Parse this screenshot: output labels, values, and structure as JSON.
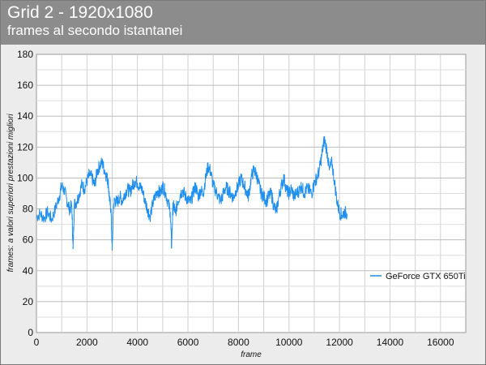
{
  "chart_data": {
    "type": "line",
    "title": "Grid 2 - 1920x1080",
    "subtitle": "frames al secondo istantanei",
    "xlabel": "frame",
    "ylabel": "frames: a valori superiori prestazioni migliori",
    "xlim": [
      0,
      17000
    ],
    "ylim": [
      0,
      180
    ],
    "x_ticks": [
      0,
      2000,
      4000,
      6000,
      8000,
      10000,
      12000,
      14000,
      16000
    ],
    "y_ticks": [
      0,
      20,
      40,
      60,
      80,
      100,
      120,
      140,
      160,
      180
    ],
    "grid": true,
    "legend_position": "right",
    "series": [
      {
        "name": "GeForce GTX 650Ti",
        "color": "#1f8ff0",
        "x": [
          0,
          150,
          300,
          450,
          600,
          750,
          900,
          1000,
          1100,
          1200,
          1300,
          1400,
          1450,
          1500,
          1600,
          1700,
          1800,
          1900,
          2000,
          2100,
          2200,
          2300,
          2400,
          2500,
          2600,
          2700,
          2800,
          2850,
          2900,
          2950,
          3000,
          3050,
          3100,
          3200,
          3300,
          3400,
          3500,
          3600,
          3700,
          3800,
          3900,
          4000,
          4100,
          4200,
          4300,
          4400,
          4500,
          4600,
          4700,
          4800,
          4900,
          5000,
          5100,
          5200,
          5300,
          5350,
          5400,
          5450,
          5500,
          5600,
          5700,
          5800,
          5900,
          6000,
          6100,
          6200,
          6300,
          6400,
          6500,
          6600,
          6700,
          6800,
          6900,
          7000,
          7100,
          7200,
          7300,
          7400,
          7500,
          7600,
          7700,
          7800,
          7900,
          8000,
          8100,
          8200,
          8300,
          8400,
          8500,
          8600,
          8700,
          8800,
          8900,
          9000,
          9100,
          9200,
          9300,
          9400,
          9500,
          9600,
          9700,
          9800,
          9900,
          10000,
          10100,
          10200,
          10300,
          10400,
          10500,
          10600,
          10700,
          10800,
          10900,
          11000,
          11100,
          11200,
          11300,
          11400,
          11500,
          11600,
          11700,
          11800,
          11900,
          12000,
          12100,
          12200,
          12300
        ],
        "values": [
          75,
          77,
          74,
          78,
          73,
          80,
          88,
          95,
          92,
          86,
          80,
          82,
          54,
          83,
          85,
          90,
          96,
          93,
          98,
          102,
          100,
          95,
          104,
          108,
          110,
          105,
          100,
          96,
          85,
          80,
          53,
          82,
          86,
          84,
          88,
          85,
          90,
          93,
          91,
          95,
          98,
          97,
          94,
          92,
          85,
          80,
          75,
          83,
          88,
          92,
          90,
          95,
          91,
          85,
          78,
          55,
          80,
          82,
          77,
          85,
          90,
          92,
          88,
          86,
          84,
          90,
          95,
          88,
          92,
          90,
          100,
          108,
          104,
          95,
          92,
          88,
          85,
          90,
          94,
          92,
          90,
          87,
          92,
          95,
          100,
          96,
          92,
          88,
          100,
          105,
          103,
          96,
          90,
          88,
          85,
          88,
          90,
          82,
          78,
          88,
          95,
          100,
          92,
          90,
          93,
          88,
          90,
          92,
          95,
          90,
          93,
          92,
          90,
          97,
          100,
          105,
          115,
          125,
          118,
          105,
          110,
          98,
          85,
          78,
          76,
          78,
          77
        ]
      }
    ]
  }
}
